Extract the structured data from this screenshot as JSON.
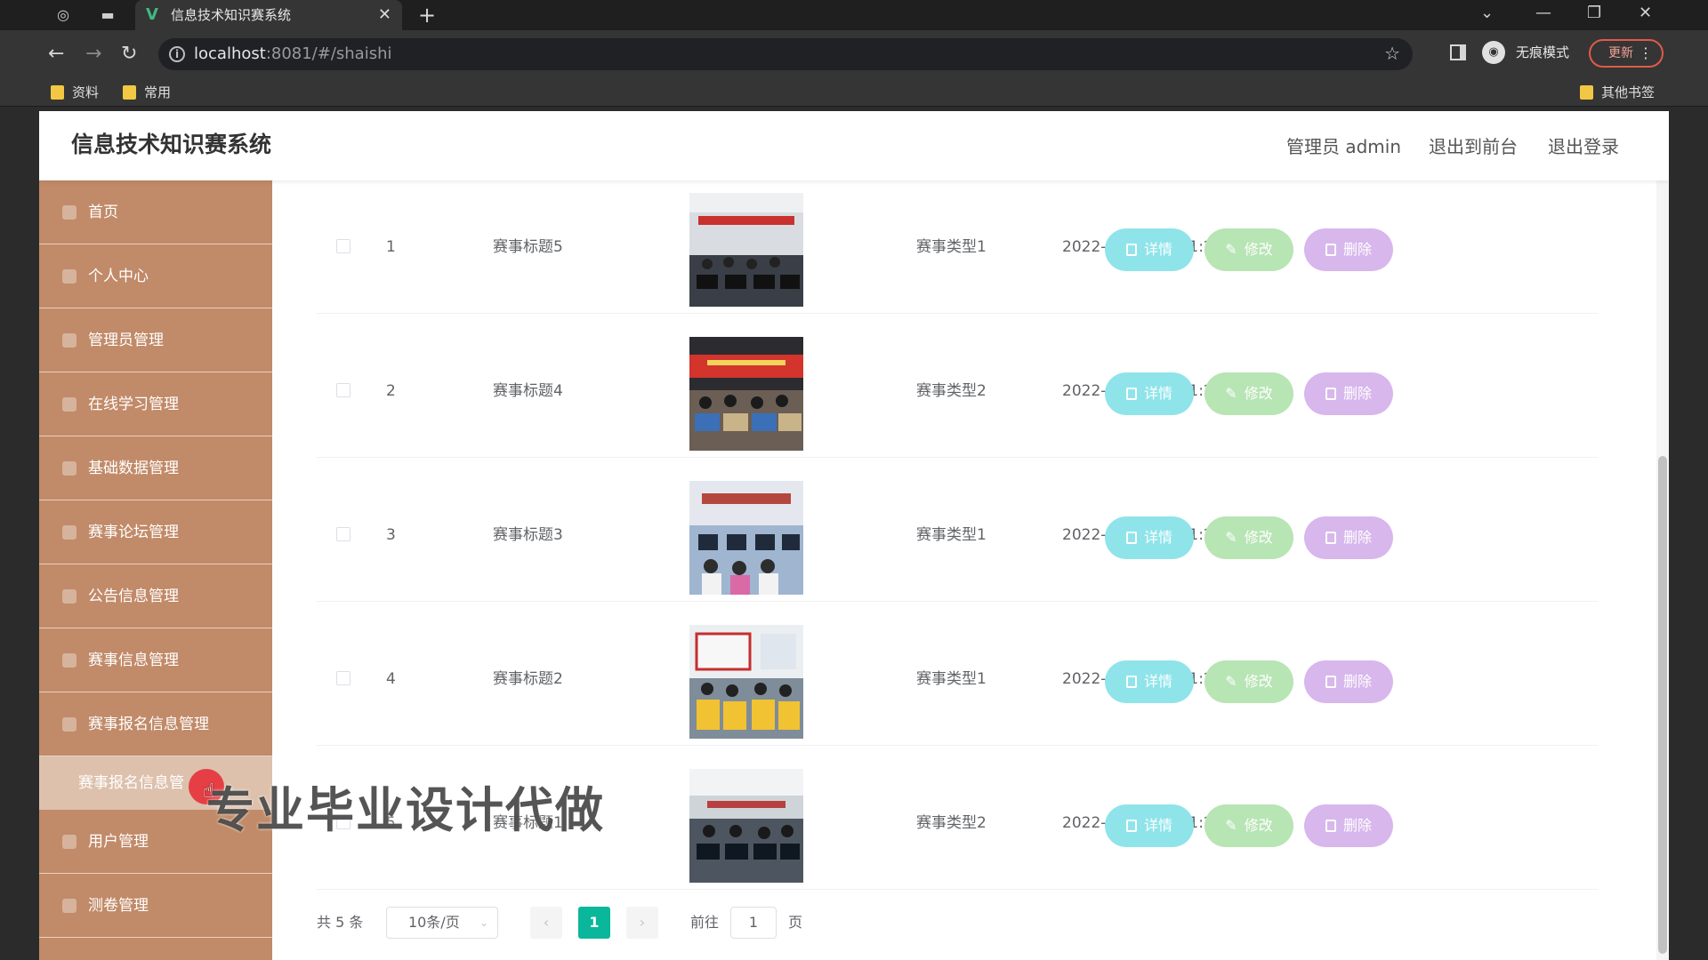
{
  "browser": {
    "tab_title": "信息技术知识赛系统",
    "url_host": "localhost",
    "url_path": ":8081/#/shaishi",
    "incognito_label": "无痕模式",
    "update_label": "更新",
    "bookmarks": [
      "资料",
      "常用"
    ],
    "other_bookmarks": "其他书签"
  },
  "app": {
    "title": "信息技术知识赛系统",
    "user_label": "管理员 admin",
    "to_front": "退出到前台",
    "logout": "退出登录"
  },
  "sidebar": {
    "items": [
      "首页",
      "个人中心",
      "管理员管理",
      "在线学习管理",
      "基础数据管理",
      "赛事论坛管理",
      "公告信息管理",
      "赛事信息管理",
      "赛事报名信息管理"
    ],
    "active_sub": "赛事报名信息管",
    "items_after": [
      "用户管理",
      "测卷管理"
    ]
  },
  "table": {
    "rows": [
      {
        "index": "1",
        "title": "赛事标题5",
        "type": "赛事类型1",
        "time": "2022-04-06 20:51:24"
      },
      {
        "index": "2",
        "title": "赛事标题4",
        "type": "赛事类型2",
        "time": "2022-04-06 20:51:24"
      },
      {
        "index": "3",
        "title": "赛事标题3",
        "type": "赛事类型1",
        "time": "2022-04-06 20:51:24"
      },
      {
        "index": "4",
        "title": "赛事标题2",
        "type": "赛事类型1",
        "time": "2022-04-06 20:51:24"
      },
      {
        "index": "5",
        "title": "赛事标题1",
        "type": "赛事类型2",
        "time": "2022-04-06 20:51:24"
      }
    ],
    "btn_detail": "详情",
    "btn_edit": "修改",
    "btn_delete": "删除"
  },
  "pager": {
    "total": "共 5 条",
    "page_size": "10条/页",
    "current": "1",
    "goto_label": "前往",
    "goto_value": "1",
    "goto_unit": "页"
  },
  "watermark": "专业毕业设计代做",
  "colors": {
    "sidebar": "#c18a68",
    "detail": "#8fe4ea",
    "edit": "#b7e5b4",
    "delete": "#d8b7ec",
    "pager_active": "#0bb79b"
  }
}
